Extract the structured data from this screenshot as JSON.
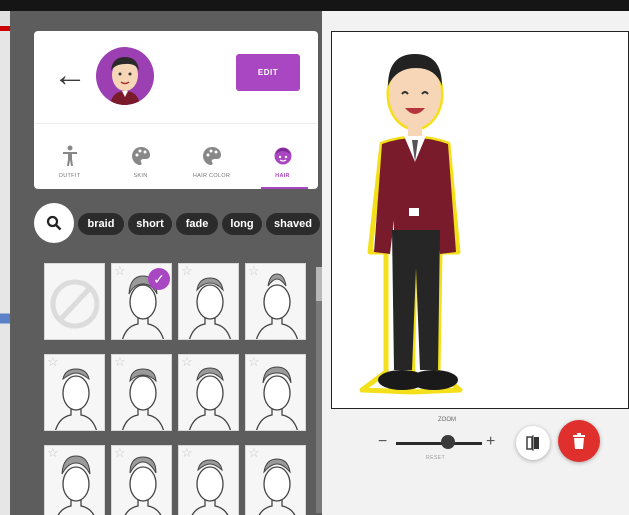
{
  "header": {
    "back_icon": "arrow-left-icon",
    "edit_label": "EDIT",
    "accent": "#a847c1"
  },
  "tabs": [
    {
      "label": "OUTFIT",
      "icon": "figure-icon",
      "active": false
    },
    {
      "label": "SKIN",
      "icon": "palette-icon",
      "active": false
    },
    {
      "label": "HAIR COLOR",
      "icon": "palette-icon",
      "active": false
    },
    {
      "label": "HAIR",
      "icon": "face-icon",
      "active": true
    }
  ],
  "search": {
    "icon": "search-icon"
  },
  "chips": [
    "braid",
    "short",
    "fade",
    "long",
    "shaved"
  ],
  "hair_grid": {
    "tiles": [
      {
        "kind": "none",
        "selected": false
      },
      {
        "kind": "hair",
        "selected": true
      },
      {
        "kind": "hair",
        "selected": false
      },
      {
        "kind": "hair",
        "selected": false
      },
      {
        "kind": "hair",
        "selected": false
      },
      {
        "kind": "hair",
        "selected": false
      },
      {
        "kind": "hair",
        "selected": false
      },
      {
        "kind": "hair",
        "selected": false
      },
      {
        "kind": "hair",
        "selected": false
      },
      {
        "kind": "hair",
        "selected": false
      },
      {
        "kind": "hair",
        "selected": false
      },
      {
        "kind": "hair",
        "selected": false
      }
    ]
  },
  "zoom": {
    "label": "ZOOM",
    "reset_label": "RESET",
    "minus": "−",
    "plus": "+",
    "level": 0.6
  },
  "actions": {
    "flip_icon": "flip-icon",
    "delete_icon": "trash-icon",
    "delete_color": "#e0302e"
  }
}
